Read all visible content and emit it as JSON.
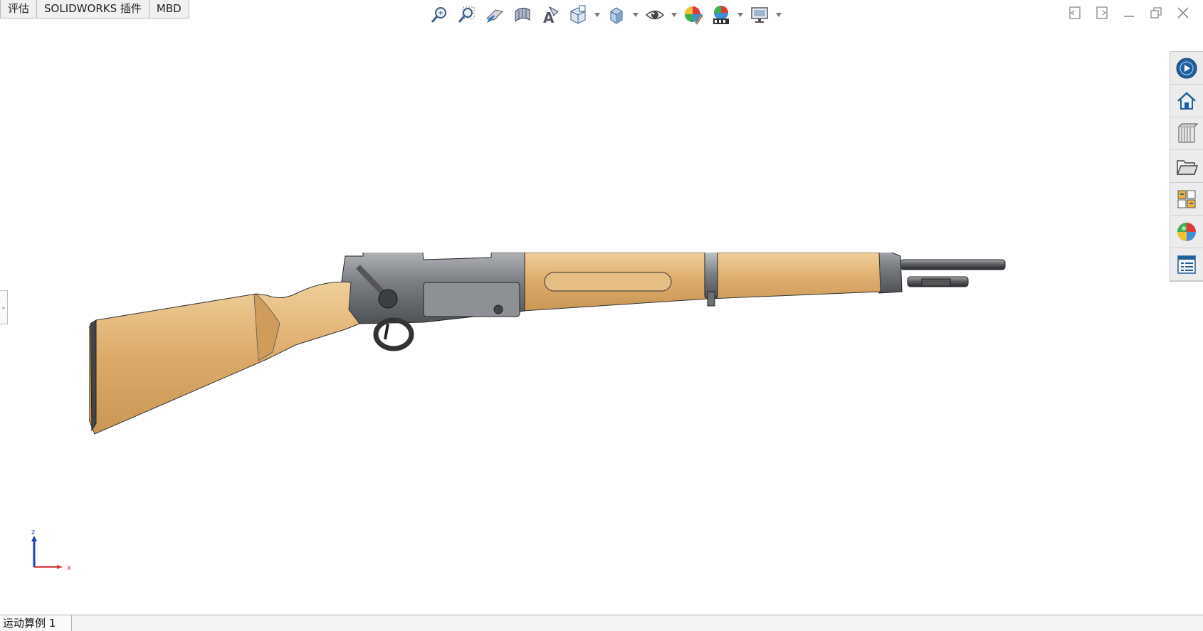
{
  "command_tabs": [
    {
      "label": "评估"
    },
    {
      "label": "SOLIDWORKS 插件"
    },
    {
      "label": "MBD"
    }
  ],
  "heads_up_toolbar": [
    {
      "name": "zoom-to-fit-icon",
      "dropdown": false
    },
    {
      "name": "zoom-to-area-icon",
      "dropdown": false
    },
    {
      "name": "previous-view-icon",
      "dropdown": false
    },
    {
      "name": "section-view-icon",
      "dropdown": false
    },
    {
      "name": "dynamic-annotation-icon",
      "dropdown": false
    },
    {
      "name": "view-orientation-icon",
      "dropdown": true
    },
    {
      "name": "display-style-icon",
      "dropdown": true
    },
    {
      "name": "hide-show-items-icon",
      "dropdown": true
    },
    {
      "name": "edit-appearance-icon",
      "dropdown": false
    },
    {
      "name": "apply-scene-icon",
      "dropdown": true
    },
    {
      "name": "view-settings-icon",
      "dropdown": true
    }
  ],
  "window_controls": [
    "tile-left-icon",
    "tile-right-icon",
    "minimize-icon",
    "restore-icon",
    "close-icon"
  ],
  "task_pane": [
    "solidworks-resources-icon",
    "home-icon",
    "design-library-icon",
    "file-explorer-icon",
    "view-palette-icon",
    "appearances-scenes-icon",
    "custom-properties-icon"
  ],
  "triad": {
    "z_label": "z",
    "x_label": "x"
  },
  "status": {
    "motion_study_tab": "运动算例 1"
  },
  "colors": {
    "wood": "#d8a867",
    "metal": "#7d8085",
    "accent_blue": "#1f5f9e"
  }
}
